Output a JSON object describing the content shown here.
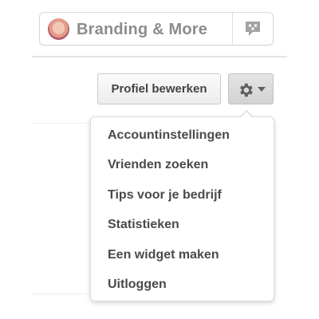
{
  "profile": {
    "name": "Branding & More",
    "avatar_icon": "user-avatar",
    "notification_icon": "speech-bubble-icon"
  },
  "actions": {
    "edit_profile_label": "Profiel bewerken",
    "settings_icon": "gear-icon",
    "settings_caret_icon": "caret-down-icon"
  },
  "settings_menu": {
    "items": [
      {
        "label": "Accountinstellingen"
      },
      {
        "label": "Vrienden zoeken"
      },
      {
        "label": "Tips voor je bedrijf"
      },
      {
        "label": "Statistieken"
      },
      {
        "label": "Een widget maken"
      },
      {
        "label": "Uitloggen"
      }
    ]
  },
  "colors": {
    "text_dark": "#4a4a4a",
    "text_muted": "#8c8c8c",
    "border": "#d9d9d9",
    "button_gray": "#d9d9d9"
  }
}
